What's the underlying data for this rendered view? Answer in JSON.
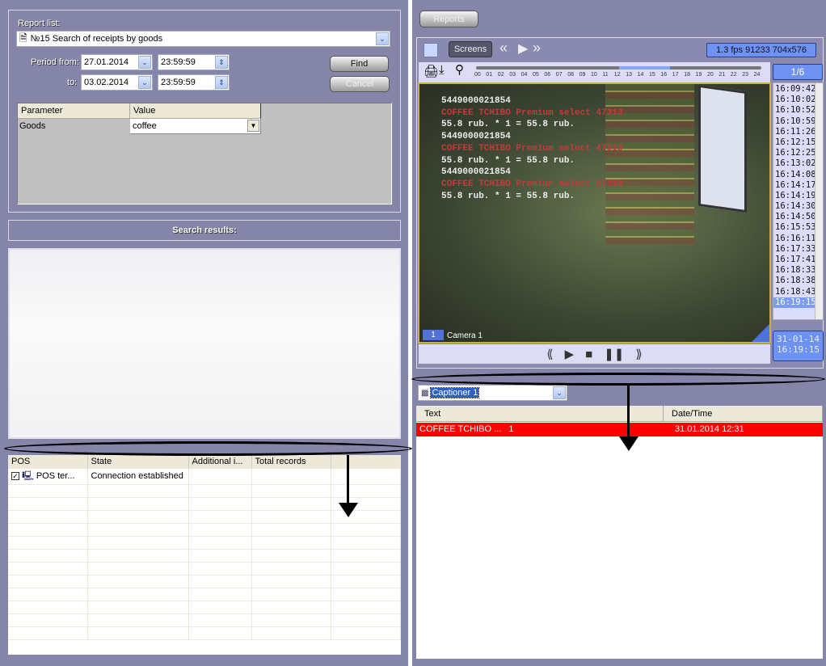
{
  "left": {
    "report_list_label": "Report list:",
    "report_selected": "№15 Search of receipts by goods",
    "period_from_label": "Period from:",
    "period_to_label": "to:",
    "date_from": "27.01.2014",
    "time_from": "23:59:59",
    "date_to": "03.02.2014",
    "time_to": "23:59:59",
    "find_label": "Find",
    "cancel_label": "Cancel",
    "param_headers": [
      "Parameter",
      "Value"
    ],
    "param_rows": [
      {
        "parameter": "Goods",
        "value": "coffee"
      }
    ],
    "search_results_label": "Search results:",
    "pos_headers": [
      "POS",
      "State",
      "Additional i...",
      "Total records"
    ],
    "pos_rows": [
      {
        "pos": "POS ter...",
        "state": "Connection established",
        "additional": "",
        "total": "",
        "checked": true
      }
    ]
  },
  "right": {
    "reports_button": "Reports",
    "screens_button": "Screens",
    "fps_info": "1.3 fps  91233 704x576",
    "page_indicator": "1/6",
    "hours": [
      "00",
      "01",
      "02",
      "03",
      "04",
      "05",
      "06",
      "07",
      "08",
      "09",
      "10",
      "11",
      "12",
      "13",
      "14",
      "15",
      "16",
      "17",
      "18",
      "19",
      "20",
      "21",
      "22",
      "23",
      "24"
    ],
    "timestamps": [
      "16:09:42",
      "16:10:02",
      "16:10:52",
      "16:10:59",
      "16:11:26",
      "16:12:15",
      "16:12:25",
      "16:13:02",
      "16:14:08",
      "16:14:17",
      "16:14:19",
      "16:14:30",
      "16:14:50",
      "16:15:53",
      "16:16:11",
      "16:17:33",
      "16:17:41",
      "16:18:33",
      "16:18:38",
      "16:18:43",
      "16:19:15"
    ],
    "selected_timestamp": "16:19:15",
    "current_date": "31-01-14",
    "current_time": "16:19:15",
    "camera_number": "1",
    "camera_name": "Camera 1",
    "overlay_lines": [
      {
        "text": "5449000021854",
        "color": "w"
      },
      {
        "text": "COFFEE TCHIBO Premium select 47313",
        "color": "r"
      },
      {
        "text": "55.8 rub. * 1 = 55.8 rub.",
        "color": "w"
      },
      {
        "text": "5449000021854",
        "color": "w"
      },
      {
        "text": "COFFEE TCHIBO Premium select 47313",
        "color": "r"
      },
      {
        "text": "55.8 rub. * 1 = 55.8 rub.",
        "color": "w"
      },
      {
        "text": "5449000021854",
        "color": "w"
      },
      {
        "text": "COFFEE TCHIBO Premium select 47313",
        "color": "r"
      },
      {
        "text": "55.8 rub. * 1 = 55.8 rub.",
        "color": "w"
      }
    ],
    "captioner_selected": "Captioner 1",
    "caption_headers": [
      "Text",
      "Date/Time"
    ],
    "caption_rows": [
      {
        "text": "COFFEE TCHIBO ...   1",
        "datetime": "31.01.2014 12:31"
      }
    ]
  },
  "colors": {
    "panel": "#8585a9",
    "highlight_row": "#ff0000",
    "accent": "#7c9ef0"
  }
}
